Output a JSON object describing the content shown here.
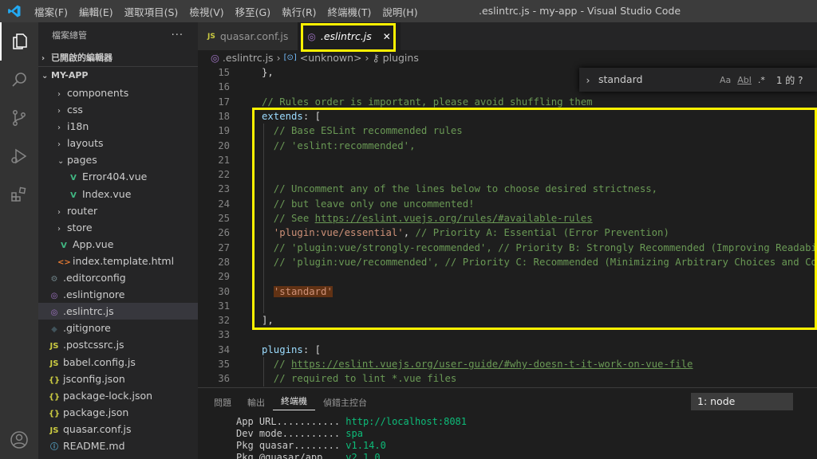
{
  "window": {
    "title": ".eslintrc.js - my-app - Visual Studio Code"
  },
  "menu": [
    "檔案(F)",
    "編輯(E)",
    "選取項目(S)",
    "檢視(V)",
    "移至(G)",
    "執行(R)",
    "終端機(T)",
    "說明(H)"
  ],
  "activity": [
    "files-icon",
    "search-icon",
    "source-control-icon",
    "run-debug-icon",
    "extensions-icon",
    "account-icon"
  ],
  "sidebar": {
    "title": "檔案總管",
    "more": "···",
    "open_editors": "已開啟的編輯器",
    "project": "MY-APP",
    "tree": [
      {
        "label": "components",
        "type": "folder",
        "depth": 1
      },
      {
        "label": "css",
        "type": "folder",
        "depth": 1
      },
      {
        "label": "i18n",
        "type": "folder",
        "depth": 1
      },
      {
        "label": "layouts",
        "type": "folder",
        "depth": 1
      },
      {
        "label": "pages",
        "type": "folder-open",
        "depth": 1
      },
      {
        "label": "Error404.vue",
        "type": "vue",
        "depth": 2
      },
      {
        "label": "Index.vue",
        "type": "vue",
        "depth": 2
      },
      {
        "label": "router",
        "type": "folder",
        "depth": 1
      },
      {
        "label": "store",
        "type": "folder",
        "depth": 1
      },
      {
        "label": "App.vue",
        "type": "vue",
        "depth": 1
      },
      {
        "label": "index.template.html",
        "type": "html",
        "depth": 1
      },
      {
        "label": ".editorconfig",
        "type": "gear",
        "depth": 0
      },
      {
        "label": ".eslintignore",
        "type": "eslint",
        "depth": 0
      },
      {
        "label": ".eslintrc.js",
        "type": "eslint",
        "depth": 0,
        "selected": true
      },
      {
        "label": ".gitignore",
        "type": "git",
        "depth": 0
      },
      {
        "label": ".postcssrc.js",
        "type": "js",
        "depth": 0
      },
      {
        "label": "babel.config.js",
        "type": "js",
        "depth": 0
      },
      {
        "label": "jsconfig.json",
        "type": "json",
        "depth": 0
      },
      {
        "label": "package-lock.json",
        "type": "json",
        "depth": 0
      },
      {
        "label": "package.json",
        "type": "json",
        "depth": 0
      },
      {
        "label": "quasar.conf.js",
        "type": "js",
        "depth": 0
      },
      {
        "label": "README.md",
        "type": "info",
        "depth": 0
      }
    ]
  },
  "tabs": [
    {
      "label": "quasar.conf.js",
      "icon": "JS",
      "active": false
    },
    {
      "label": ".eslintrc.js",
      "icon": "◎",
      "active": true,
      "close": "✕"
    }
  ],
  "breadcrumb": [
    ".eslintrc.js",
    "<unknown>",
    "plugins"
  ],
  "find": {
    "value": "standard",
    "opts": [
      "Aa",
      "Abl",
      ".*"
    ],
    "result": "1 的 ?"
  },
  "code": {
    "line_numbers": [
      "15",
      "16",
      "17",
      "18",
      "19",
      "20",
      "21",
      "22",
      "23",
      "24",
      "25",
      "26",
      "27",
      "28",
      "29",
      "30",
      "31",
      "32",
      "33",
      "34",
      "35",
      "36"
    ],
    "lines": [
      [
        {
          "t": "},",
          "c": "p"
        }
      ],
      [],
      [
        {
          "t": "// Rules order is important, please avoid shuffling them",
          "c": "c"
        }
      ],
      [
        {
          "t": "extends",
          "c": "k"
        },
        {
          "t": ": [",
          "c": "p"
        }
      ],
      [
        {
          "t": "  // Base ESLint recommended rules",
          "c": "c"
        }
      ],
      [
        {
          "t": "  // 'eslint:recommended',",
          "c": "c"
        }
      ],
      [],
      [],
      [
        {
          "t": "  // Uncomment any of the lines below to choose desired strictness,",
          "c": "c"
        }
      ],
      [
        {
          "t": "  // but leave only one uncommented!",
          "c": "c"
        }
      ],
      [
        {
          "t": "  // See ",
          "c": "c"
        },
        {
          "t": "https://eslint.vuejs.org/rules/#available-rules",
          "c": "u"
        }
      ],
      [
        {
          "t": "  'plugin:vue/essential'",
          "c": "s"
        },
        {
          "t": ", ",
          "c": "p"
        },
        {
          "t": "// Priority A: Essential (Error Prevention)",
          "c": "c"
        }
      ],
      [
        {
          "t": "  // 'plugin:vue/strongly-recommended', // Priority B: Strongly Recommended (Improving Readabi",
          "c": "c"
        }
      ],
      [
        {
          "t": "  // 'plugin:vue/recommended', // Priority C: Recommended (Minimizing Arbitrary Choices and Co",
          "c": "c"
        }
      ],
      [],
      [
        {
          "t": "  ",
          "c": "p"
        },
        {
          "t": "'standard'",
          "c": "s",
          "m": true
        }
      ],
      [],
      [
        {
          "t": "],",
          "c": "p"
        }
      ],
      [],
      [
        {
          "t": "plugins",
          "c": "k"
        },
        {
          "t": ": [",
          "c": "p"
        }
      ],
      [
        {
          "t": "  // ",
          "c": "c"
        },
        {
          "t": "https://eslint.vuejs.org/user-guide/#why-doesn-t-it-work-on-vue-file",
          "c": "u"
        }
      ],
      [
        {
          "t": "  // required to lint *.vue files",
          "c": "c"
        }
      ]
    ]
  },
  "panel": {
    "tabs": [
      "問題",
      "輸出",
      "終端機",
      "偵錯主控台"
    ],
    "active_tab": "終端機",
    "terminal_select": "1: node",
    "terminal": [
      {
        "k": "App URL...........",
        "v": "http://localhost:8081"
      },
      {
        "k": "Dev mode..........",
        "v": "spa"
      },
      {
        "k": "Pkg quasar........",
        "v": "v1.14.0"
      },
      {
        "k": "Pkg @quasar/app...",
        "v": "v2.1.0"
      }
    ]
  },
  "colors": {
    "accent": "#007acc",
    "highlight_box": "#fff200",
    "vue": "#41b883",
    "comment": "#6a9955",
    "string": "#ce9178",
    "keyword": "#9cdcfe"
  }
}
